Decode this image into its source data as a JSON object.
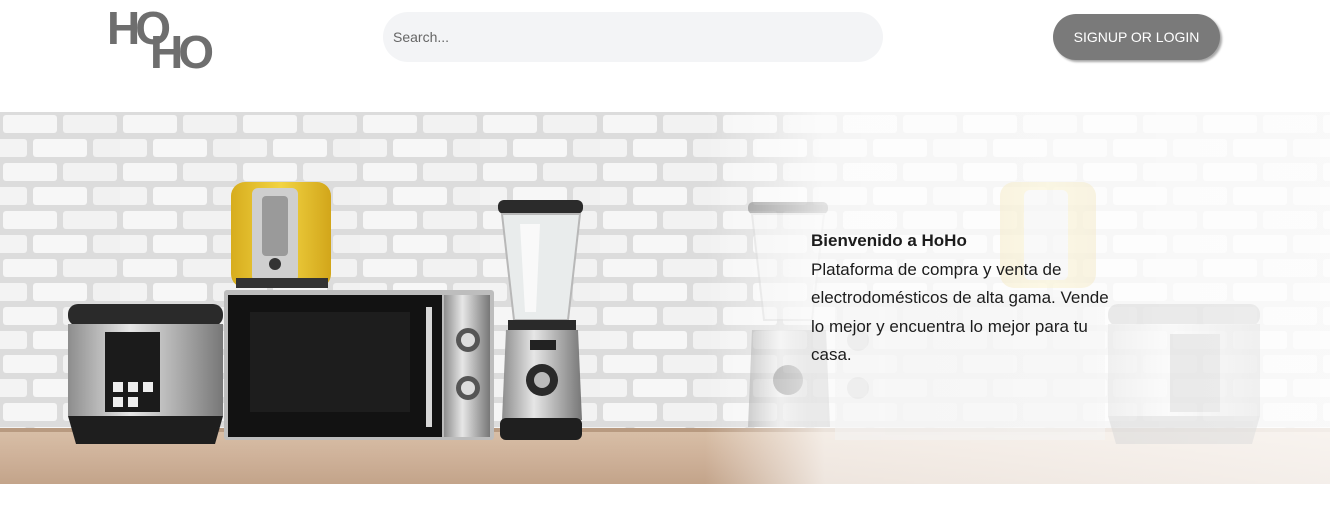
{
  "header": {
    "logo": {
      "line1": "HO",
      "line2": "HO"
    },
    "search": {
      "placeholder": "Search...",
      "value": ""
    },
    "login_button_label": "SIGNUP OR LOGIN"
  },
  "hero": {
    "title": "Bienvenido a HoHo",
    "body": "Plataforma de compra y venta de electrodomésticos de alta gama. Vende lo mejor y encuentra lo mejor para tu casa."
  },
  "colors": {
    "logo": "#6e6e6e",
    "button_bg": "#7a7a7a",
    "search_bg": "#f3f4f6",
    "toaster_yellow": "#e8c52c"
  },
  "icons": [
    "search-field",
    "hero-appliances-image"
  ]
}
